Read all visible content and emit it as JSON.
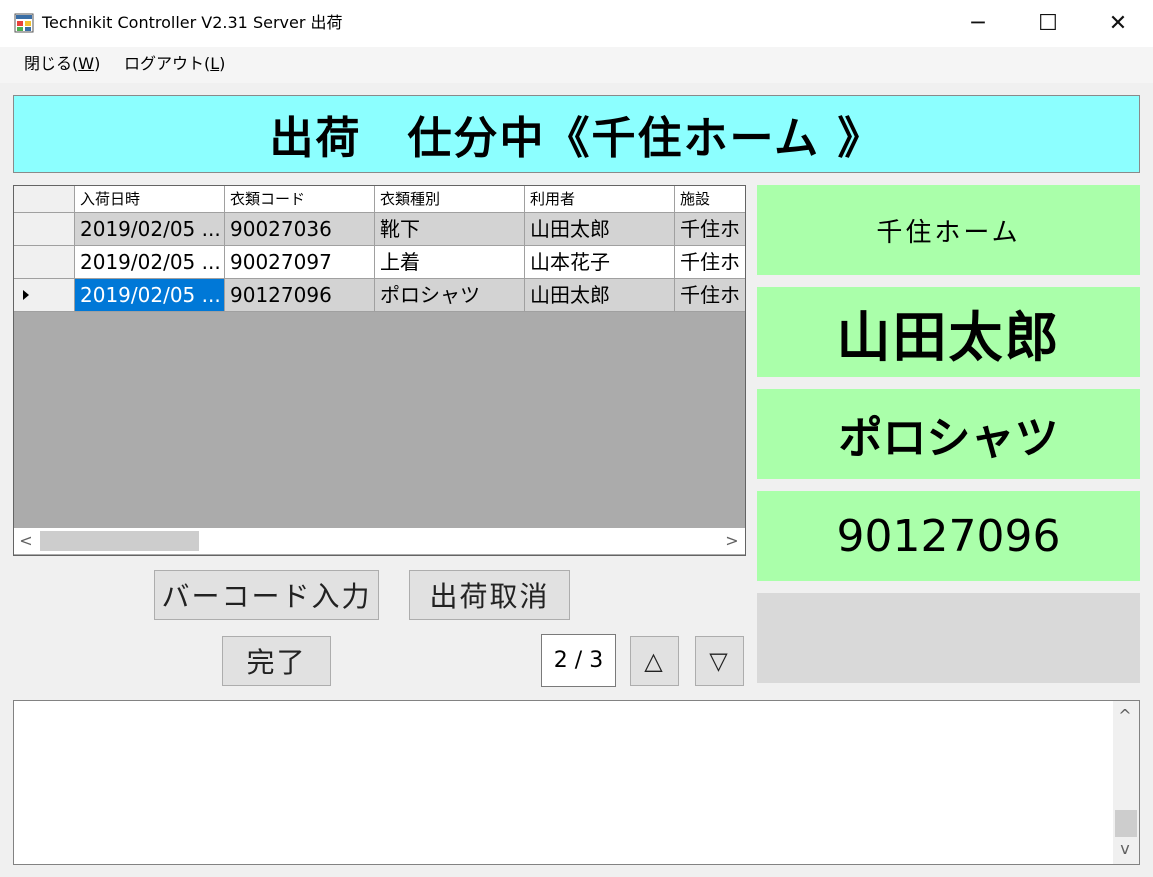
{
  "window": {
    "title": "Technikit Controller V2.31 Server  出荷",
    "minimize_glyph": "─",
    "maximize_glyph": "☐",
    "close_glyph": "✕"
  },
  "menu": {
    "close": {
      "label": "閉じる(",
      "key": "W",
      "suffix": ")"
    },
    "logout": {
      "label": "ログアウト(",
      "key": "L",
      "suffix": ")"
    }
  },
  "banner": {
    "text": "出荷　仕分中《千住ホーム 》"
  },
  "grid": {
    "columns": [
      "入荷日時",
      "衣類コード",
      "衣類種別",
      "利用者",
      "施設"
    ],
    "rows": [
      {
        "cells": [
          "2019/02/05 ...",
          "90027036",
          "靴下",
          "山田太郎",
          "千住ホ"
        ],
        "style": "grey",
        "current": false
      },
      {
        "cells": [
          "2019/02/05 ...",
          "90027097",
          "上着",
          "山本花子",
          "千住ホ"
        ],
        "style": "white",
        "current": false
      },
      {
        "cells": [
          "2019/02/05 ...",
          "90127096",
          "ポロシャツ",
          "山田太郎",
          "千住ホ"
        ],
        "style": "grey",
        "current": true
      }
    ]
  },
  "buttons": {
    "barcode": "バーコード入力",
    "cancel_shipment": "出荷取消",
    "complete": "完了",
    "up": "△",
    "down": "▽"
  },
  "pager": {
    "text": "2 / 3"
  },
  "details": {
    "facility": "千住ホーム",
    "user": "山田太郎",
    "garment_type": "ポロシャツ",
    "garment_code": "90127096"
  },
  "scroll": {
    "left": "<",
    "right": ">",
    "up": "^",
    "down": "v"
  },
  "colors": {
    "banner": "#8cffff",
    "panel": "#aaffaa",
    "selection": "#0078d7"
  }
}
